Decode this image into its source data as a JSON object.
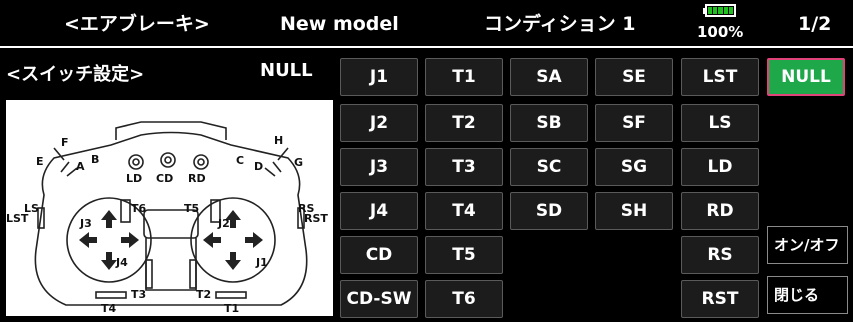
{
  "header": {
    "screen_title": "<エアブレーキ>",
    "model_name": "New model",
    "condition": "コンディション 1",
    "battery_percent": "100%",
    "battery_level": 1.0,
    "page": "1/2"
  },
  "sub": {
    "title": "<スイッチ設定>",
    "current_selection": "NULL"
  },
  "switch_grid": {
    "rows": [
      [
        "J1",
        "T1",
        "SA",
        "SE",
        "LST",
        "NULL"
      ],
      [
        "J2",
        "T2",
        "SB",
        "SF",
        "LS"
      ],
      [
        "J3",
        "T3",
        "SC",
        "SG",
        "LD"
      ],
      [
        "J4",
        "T4",
        "SD",
        "SH",
        "RD"
      ],
      [
        "CD",
        "T5",
        "",
        "",
        "RS"
      ],
      [
        "CD-SW",
        "T6",
        "",
        "",
        "RST"
      ]
    ],
    "selected": "NULL"
  },
  "side_buttons": {
    "on_off": "オン/オフ",
    "close": "閉じる"
  },
  "diagram": {
    "labels": [
      "F",
      "E",
      "A",
      "B",
      "LD",
      "CD",
      "RD",
      "H",
      "G",
      "C",
      "D",
      "LS",
      "LST",
      "T6",
      "T5",
      "RS",
      "RST",
      "J3",
      "J4",
      "J2",
      "J1",
      "T3",
      "T2",
      "T4",
      "T1"
    ]
  },
  "colors": {
    "selected_bg": "#1ea84a",
    "selected_border": "#e0437a",
    "battery_fill": "#1fc01f"
  }
}
